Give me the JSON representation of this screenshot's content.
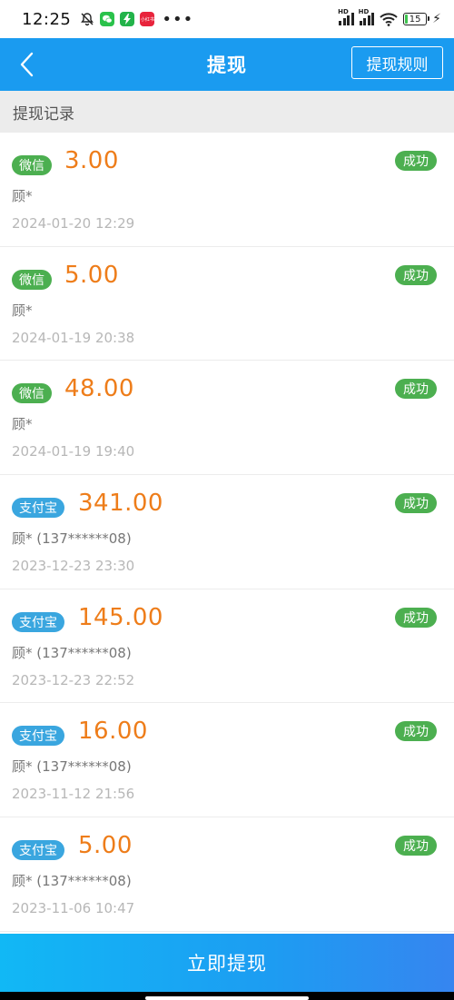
{
  "status_bar": {
    "time": "12:25",
    "battery": "15",
    "app_badge": "小红书"
  },
  "header": {
    "title": "提现",
    "rules_button": "提现规则"
  },
  "section_title": "提现记录",
  "records": [
    {
      "channel": "微信",
      "channel_type": "wechat",
      "amount": "3.00",
      "status": "成功",
      "name": "顾*",
      "time": "2024-01-20 12:29"
    },
    {
      "channel": "微信",
      "channel_type": "wechat",
      "amount": "5.00",
      "status": "成功",
      "name": "顾*",
      "time": "2024-01-19 20:38"
    },
    {
      "channel": "微信",
      "channel_type": "wechat",
      "amount": "48.00",
      "status": "成功",
      "name": "顾*",
      "time": "2024-01-19 19:40"
    },
    {
      "channel": "支付宝",
      "channel_type": "alipay",
      "amount": "341.00",
      "status": "成功",
      "name": "顾* (137******08)",
      "time": "2023-12-23 23:30"
    },
    {
      "channel": "支付宝",
      "channel_type": "alipay",
      "amount": "145.00",
      "status": "成功",
      "name": "顾* (137******08)",
      "time": "2023-12-23 22:52"
    },
    {
      "channel": "支付宝",
      "channel_type": "alipay",
      "amount": "16.00",
      "status": "成功",
      "name": "顾* (137******08)",
      "time": "2023-11-12 21:56"
    },
    {
      "channel": "支付宝",
      "channel_type": "alipay",
      "amount": "5.00",
      "status": "成功",
      "name": "顾* (137******08)",
      "time": "2023-11-06 10:47"
    }
  ],
  "withdraw_button": "立即提现",
  "colors": {
    "primary": "#1a9bf0",
    "amount": "#ee7d1a",
    "success": "#4caf50",
    "wechat": "#4caf50",
    "alipay": "#3aa6df"
  },
  "icons": [
    "back-arrow-icon",
    "bell-off-icon",
    "wechat-icon",
    "signal-icon",
    "wifi-icon",
    "battery-icon",
    "charging-icon"
  ]
}
